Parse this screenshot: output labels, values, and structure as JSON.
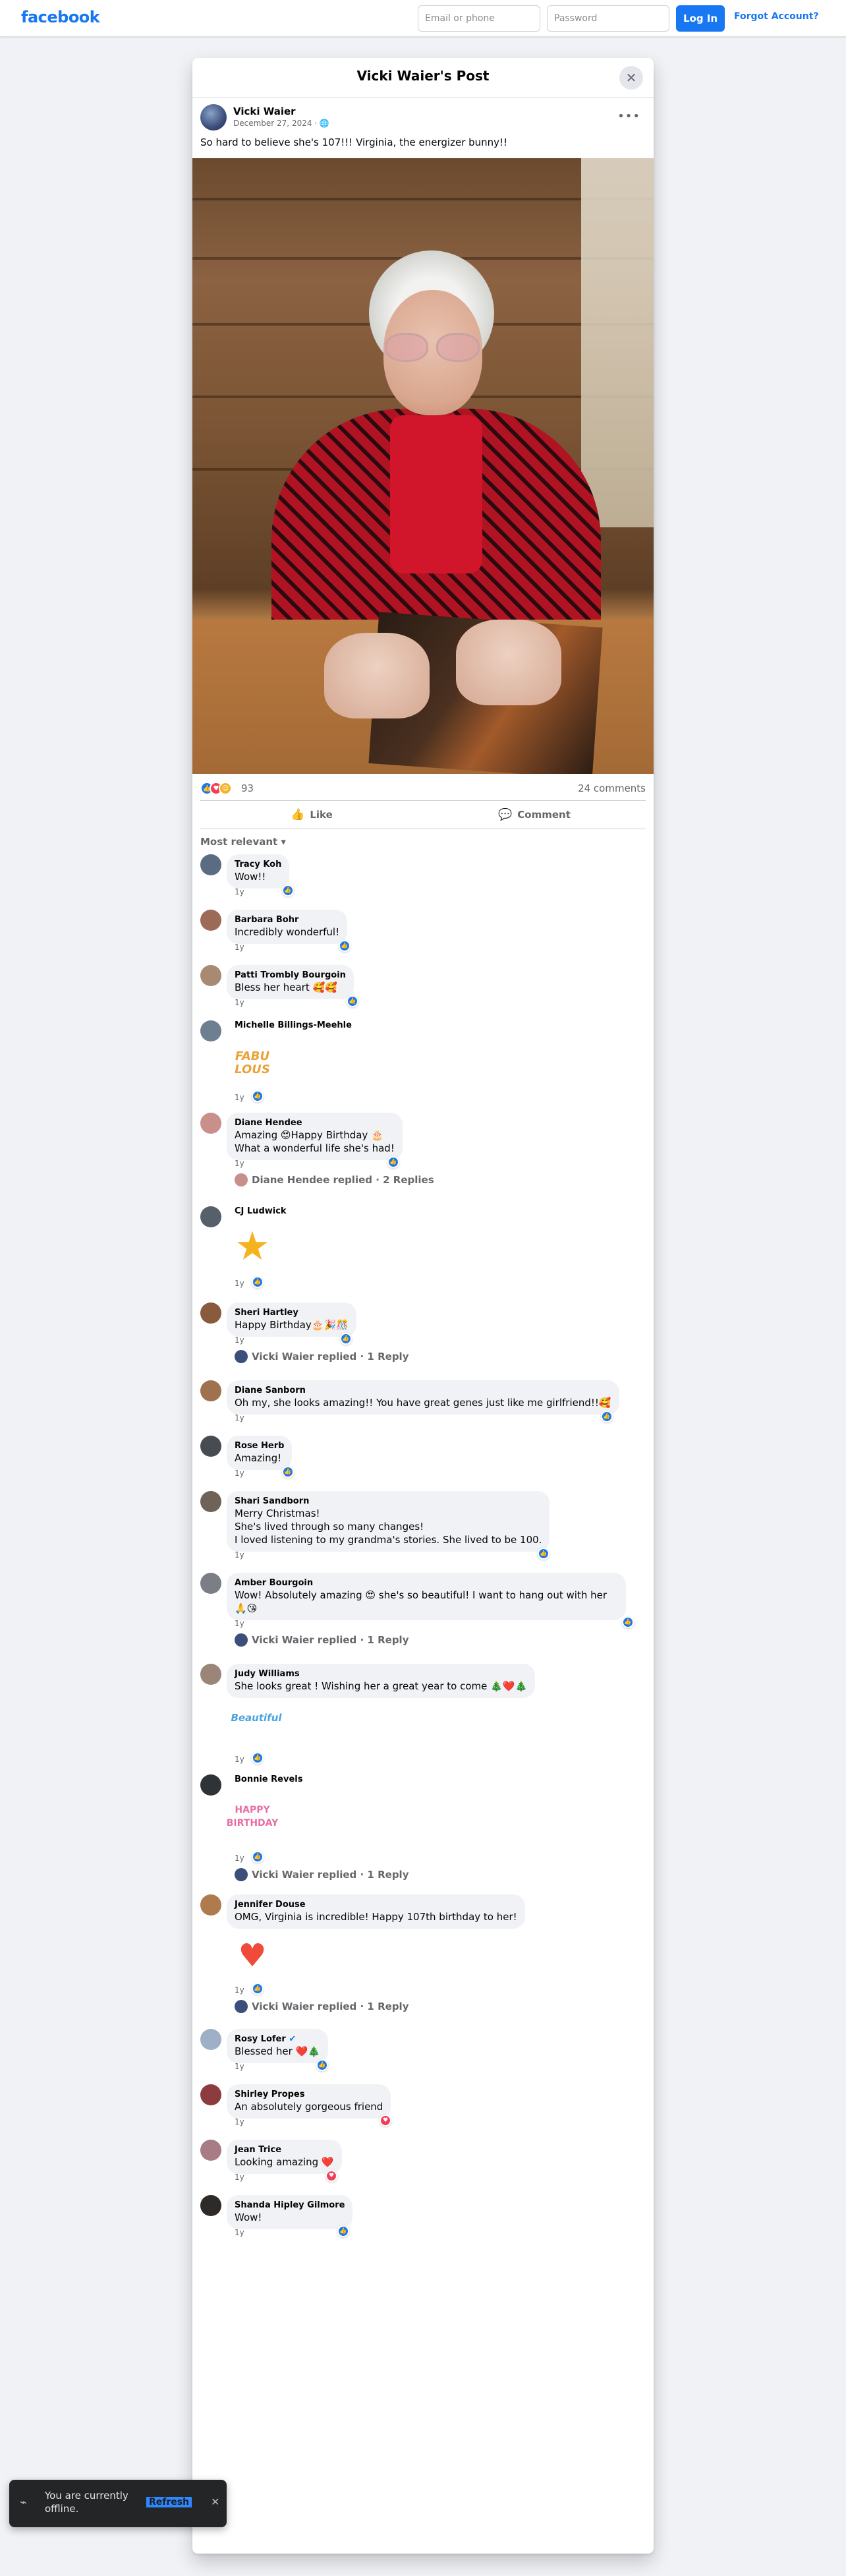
{
  "topbar": {
    "logo": "facebook",
    "email_placeholder": "Email or phone",
    "password_placeholder": "Password",
    "login_label": "Log In",
    "forgot_label": "Forgot Account?"
  },
  "modal": {
    "title": "Vicki Waier's Post",
    "close_icon": "close-icon"
  },
  "post": {
    "author": "Vicki Waier",
    "date": "December 27, 2024 · ",
    "text": "So hard to believe she's 107!!!  Virginia, the energizer bunny!!",
    "reaction_count": "93",
    "comment_count": "24 comments",
    "like_label": "Like",
    "comment_label": "Comment",
    "sort_label": "Most relevant"
  },
  "comments": [
    {
      "name": "Tracy Koh",
      "text": "Wow!!",
      "time": "1y"
    },
    {
      "name": "Barbara Bohr",
      "text": "Incredibly wonderful!",
      "time": "1y"
    },
    {
      "name": "Patti Trombly Bourgoin",
      "text": "Bless her heart 🥰🥰",
      "time": "1y"
    },
    {
      "name": "Michelle Billings-Meehle",
      "text": "",
      "time": "1y",
      "sticker": "FABU LOUS"
    },
    {
      "name": "Diane Hendee",
      "text": "Amazing 😍Happy Birthday 🎂\nWhat a wonderful life she's had!",
      "time": "1y",
      "replies": "Diane Hendee replied · 2 Replies"
    },
    {
      "name": "CJ Ludwick",
      "text": "",
      "time": "1y",
      "sticker": "★"
    },
    {
      "name": "Sheri Hartley",
      "text": "Happy Birthday🎂🎉🎊",
      "time": "1y",
      "replies": "Vicki Waier replied · 1 Reply"
    },
    {
      "name": "Diane Sanborn",
      "text": "Oh my, she looks amazing!! You have great genes just like me girlfriend!!🥰",
      "time": "1y"
    },
    {
      "name": "Rose Herb",
      "text": "Amazing!",
      "time": "1y"
    },
    {
      "name": "Shari Sandborn",
      "text": "Merry Christmas!\nShe's lived through so many changes!\nI loved listening to my grandma's stories. She lived to be 100.",
      "time": "1y"
    },
    {
      "name": "Amber Bourgoin",
      "text": "Wow! Absolutely amazing 😍 she's so beautiful! I want to hang out with her 🙏😘",
      "time": "1y",
      "replies": "Vicki Waier replied · 1 Reply"
    },
    {
      "name": "Judy Williams",
      "text": "She looks great ! Wishing her a great year to come 🎄❤️🎄",
      "time": "1y",
      "sticker": "Beautiful"
    },
    {
      "name": "Bonnie Revels",
      "text": "",
      "time": "1y",
      "sticker": "HAPPY BIRTHDAY",
      "replies": "Vicki Waier replied · 1 Reply"
    },
    {
      "name": "Jennifer Douse",
      "text": "OMG, Virginia is incredible! Happy 107th birthday to her!",
      "time": "1y",
      "sticker": "♥",
      "replies": "Vicki Waier replied · 1 Reply"
    },
    {
      "name": "Rosy Lofer",
      "text": "Blessed her ❤️🎄",
      "time": "1y"
    },
    {
      "name": "Shirley Propes",
      "text": "An absolutely gorgeous friend",
      "time": "1y"
    },
    {
      "name": "Jean Trice",
      "text": "Looking amazing ❤️",
      "time": "1y"
    },
    {
      "name": "Shanda Hipley Gilmore",
      "text": "Wow!",
      "time": "1y"
    }
  ],
  "toast": {
    "text": "You are currently offline.",
    "refresh_label": "Refresh",
    "close_icon": "close-icon"
  },
  "colors": {
    "brand": "#1877f2",
    "background": "#f0f2f5",
    "heart": "#f33e58"
  }
}
